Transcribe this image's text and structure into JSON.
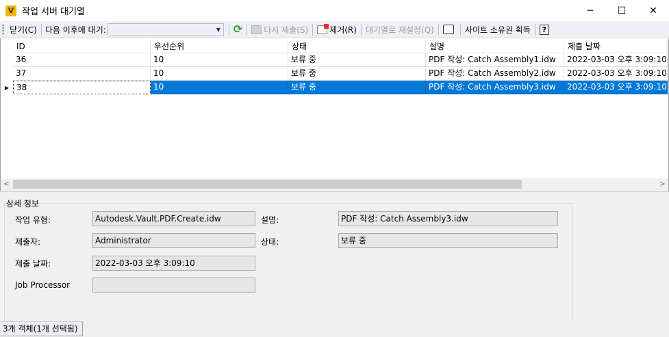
{
  "window": {
    "title": "작업 서버 대기열",
    "app_icon_letter": "V",
    "minimize_glyph": "─",
    "maximize_glyph": "☐",
    "close_glyph": "✕"
  },
  "toolbar": {
    "close_label": "닫기(C)",
    "wait_label": "다음 이후에 대기:",
    "wait_value": "",
    "resubmit_label": "다시 제출(S)",
    "remove_label": "제거(R)",
    "reset_queue_label": "대기열로 재설정(Q)",
    "site_ownership_label": "사이트 소유권 획득",
    "help_glyph": "?"
  },
  "grid": {
    "columns": [
      "ID",
      "우선순위",
      "상태",
      "설명",
      "제출 날짜"
    ],
    "rows": [
      {
        "id": "36",
        "priority": "10",
        "status": "보류 중",
        "description": "PDF 작성: Catch Assembly1.idw",
        "date": "2022-03-03 오후 3:09:10",
        "selected": false
      },
      {
        "id": "37",
        "priority": "10",
        "status": "보류 중",
        "description": "PDF 작성: Catch Assembly2.idw",
        "date": "2022-03-03 오후 3:09:10",
        "selected": false
      },
      {
        "id": "38",
        "priority": "10",
        "status": "보류 중",
        "description": "PDF 작성: Catch Assembly3.idw",
        "date": "2022-03-03 오후 3:09:10",
        "selected": true
      }
    ]
  },
  "details": {
    "title": "상세 정보",
    "job_type_label": "작업 유형:",
    "job_type_value": "Autodesk.Vault.PDF.Create.idw",
    "submitter_label": "제출자:",
    "submitter_value": "Administrator",
    "submit_date_label": "제출 날짜:",
    "submit_date_value": "2022-03-03 오후 3:09:10",
    "job_processor_label": "Job Processor",
    "job_processor_value": "",
    "description_label": "설명:",
    "description_value": "PDF 작성: Catch Assembly3.idw",
    "status_label": "상태:",
    "status_value": "보류 중"
  },
  "statusbar": {
    "text": "3개 객체(1개 선택됨)"
  },
  "colors": {
    "selection": "#0078d7",
    "toolbar_bg": "#eef0f6",
    "refresh_icon": "#3a9a2e"
  }
}
